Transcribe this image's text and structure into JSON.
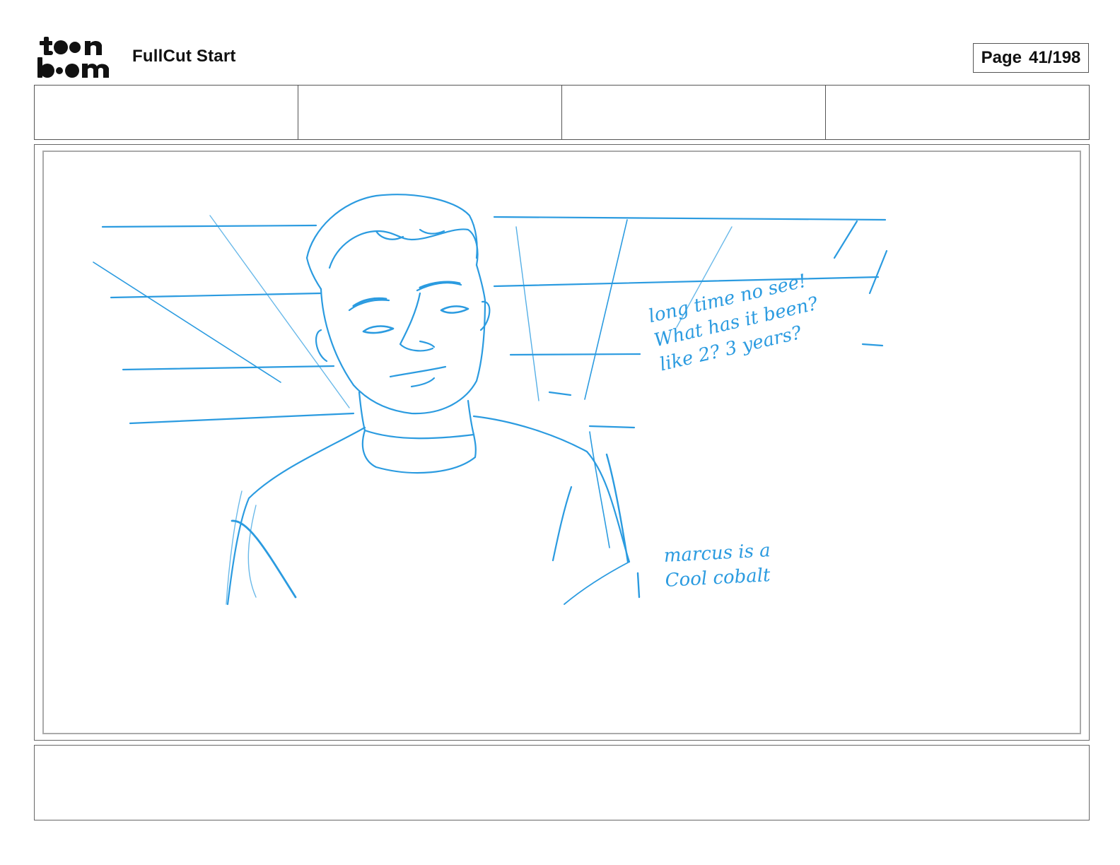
{
  "header": {
    "logo_top": "toon",
    "logo_bottom": "boom",
    "project_title": "FullCut Start",
    "page_label": "Page",
    "page_number": "41/198"
  },
  "header_fields": [
    "",
    "",
    "",
    ""
  ],
  "panel": {
    "notes": {
      "dialogue": [
        "long time no see!",
        "What has it been?",
        "like 2? 3 years?"
      ],
      "color": [
        "marcus is a",
        "Cool cobalt"
      ]
    }
  },
  "dialog_box": {
    "text": ""
  },
  "colors": {
    "sketch": "#2b9be0",
    "frame": "#666666",
    "ink": "#111111"
  }
}
